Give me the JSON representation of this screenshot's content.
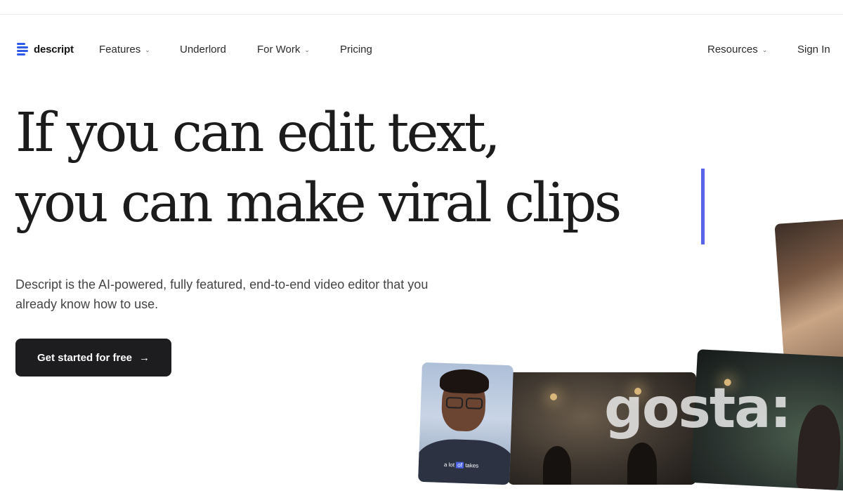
{
  "header": {
    "brand": "descript",
    "nav": [
      {
        "label": "Features",
        "has_menu": true
      },
      {
        "label": "Underlord",
        "has_menu": false
      },
      {
        "label": "For Work",
        "has_menu": true
      },
      {
        "label": "Pricing",
        "has_menu": false
      }
    ],
    "right_nav": [
      {
        "label": "Resources",
        "has_menu": true
      },
      {
        "label": "Sign In",
        "has_menu": false
      }
    ]
  },
  "hero": {
    "headline_line1": "If you can edit text,",
    "headline_line2": "you can make viral clips",
    "subheading": "Descript is the AI-powered, fully featured, end-to-end video editor that you already know how to use.",
    "cta_label": "Get started for free",
    "cta_icon": "arrow-right-icon"
  },
  "collage": {
    "caption_before": "a lot ",
    "caption_highlight": "of",
    "caption_after": " takes"
  },
  "watermark": "gosta:",
  "colors": {
    "brand": "#2f5bea",
    "caret": "#5865e8",
    "cta_bg": "#1d1d1f",
    "text": "#1c1c1c"
  }
}
